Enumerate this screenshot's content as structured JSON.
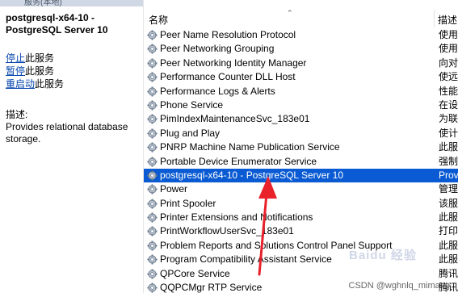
{
  "window": {
    "top_strip_text": "服务(本地)"
  },
  "left_pane": {
    "service_title": "postgresql-x64-10 - PostgreSQL Server 10",
    "actions": [
      {
        "link": "停止",
        "rest": "此服务"
      },
      {
        "link": "暂停",
        "rest": "此服务"
      },
      {
        "link": "重启动",
        "rest": "此服务"
      }
    ],
    "description_label": "描述:",
    "description": "Provides relational database storage."
  },
  "list": {
    "header": {
      "name": "名称",
      "description": "描述"
    },
    "rows": [
      {
        "name": "Peer Name Resolution Protocol",
        "desc": "使用"
      },
      {
        "name": "Peer Networking Grouping",
        "desc": "使用"
      },
      {
        "name": "Peer Networking Identity Manager",
        "desc": "向对"
      },
      {
        "name": "Performance Counter DLL Host",
        "desc": "使远"
      },
      {
        "name": "Performance Logs & Alerts",
        "desc": "性能"
      },
      {
        "name": "Phone Service",
        "desc": "在设"
      },
      {
        "name": "PimIndexMaintenanceSvc_183e01",
        "desc": "为联"
      },
      {
        "name": "Plug and Play",
        "desc": "使计"
      },
      {
        "name": "PNRP Machine Name Publication Service",
        "desc": "此服"
      },
      {
        "name": "Portable Device Enumerator Service",
        "desc": "强制"
      },
      {
        "name": "postgresql-x64-10 - PostgreSQL Server 10",
        "desc": "Prov",
        "selected": true
      },
      {
        "name": "Power",
        "desc": "管理"
      },
      {
        "name": "Print Spooler",
        "desc": "该服"
      },
      {
        "name": "Printer Extensions and Notifications",
        "desc": "此服"
      },
      {
        "name": "PrintWorkflowUserSvc_183e01",
        "desc": "打印"
      },
      {
        "name": "Problem Reports and Solutions Control Panel Support",
        "desc": "此服"
      },
      {
        "name": "Program Compatibility Assistant Service",
        "desc": "此服"
      },
      {
        "name": "QPCore Service",
        "desc": "腾讯"
      },
      {
        "name": "QQPCMgr RTP Service",
        "desc": "腾讯"
      }
    ]
  },
  "overlay": {
    "watermark": "CSDN @wghnlq_mimang",
    "baidu_mark": "Baidu 经验",
    "arrow_color": "#e8212b",
    "selection_color": "#0a5bd3",
    "link_color": "#0645ad"
  }
}
